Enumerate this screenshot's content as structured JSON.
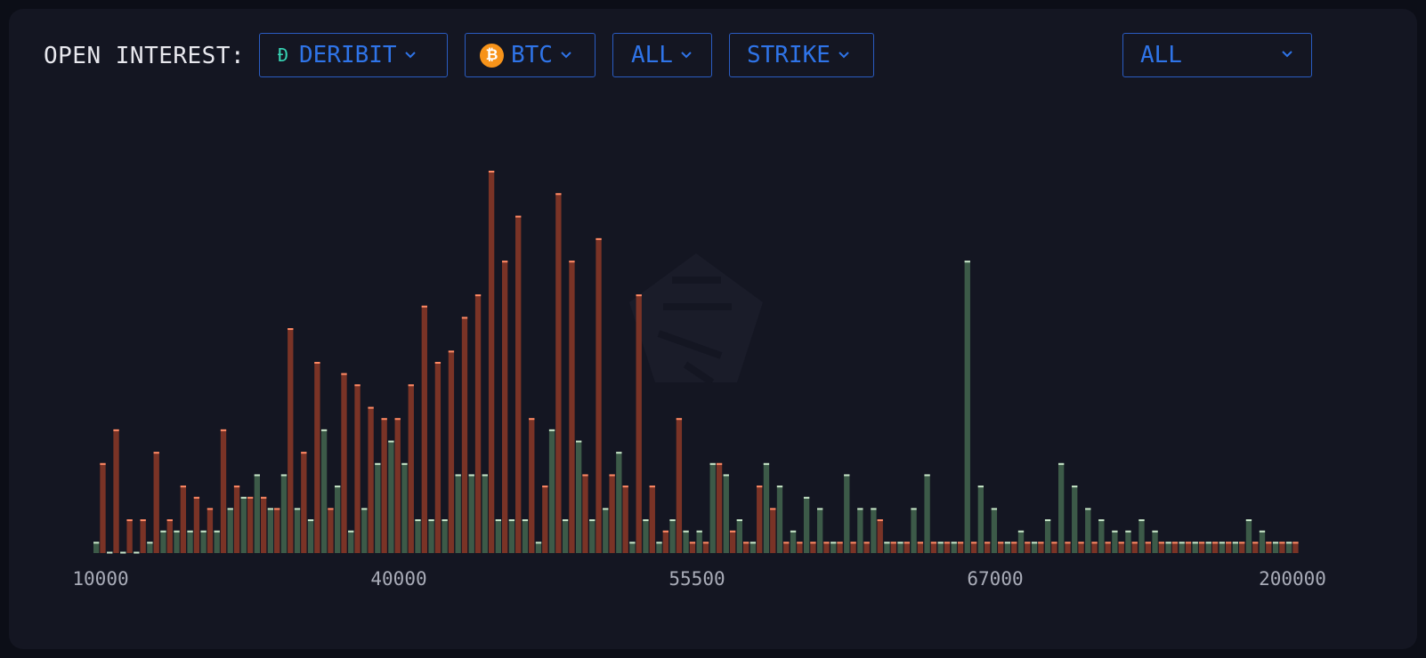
{
  "header": {
    "title": "OPEN INTEREST:",
    "exchange": "DERIBIT",
    "asset": "BTC",
    "expiry": "ALL",
    "group_by": "STRIKE",
    "filter": "ALL"
  },
  "icons": {
    "exchange": "deribit-icon",
    "asset": "bitcoin-icon",
    "dropdown": "chevron-down-icon",
    "watermark": "logo-watermark"
  },
  "colors": {
    "calls": "#3c5a48",
    "puts": "#7a3326",
    "accent": "#2f74e8"
  },
  "chart_data": {
    "type": "bar",
    "title": "",
    "xlabel": "",
    "ylabel": "",
    "x_tick_labels": [
      "10000",
      "40000",
      "55500",
      "67000",
      "200000"
    ],
    "grid": false,
    "y_axis_visible": false,
    "series": [
      {
        "color": "#3c5a48",
        "values": [
          1,
          0,
          0,
          0,
          1,
          2,
          2,
          2,
          2,
          2,
          4,
          5,
          7,
          4,
          7,
          4,
          3,
          11,
          6,
          2,
          4,
          8,
          10,
          8,
          3,
          3,
          3,
          7,
          7,
          7,
          3,
          3,
          3,
          1,
          11,
          3,
          10,
          3,
          4,
          9,
          1,
          3,
          1,
          3,
          2,
          2,
          8,
          7,
          3,
          1,
          8,
          6,
          2,
          5,
          4,
          1,
          7,
          4,
          4,
          1,
          1,
          4,
          7,
          1,
          1,
          26,
          6,
          4,
          1,
          2,
          1,
          3,
          8,
          6,
          4,
          3,
          2,
          2,
          3,
          2,
          1,
          1,
          1,
          1,
          1,
          1,
          3,
          2,
          1,
          1
        ]
      },
      {
        "color": "#7a3326",
        "values": [
          8,
          11,
          3,
          3,
          9,
          3,
          6,
          5,
          4,
          11,
          6,
          5,
          5,
          4,
          20,
          9,
          17,
          4,
          16,
          15,
          13,
          12,
          12,
          15,
          22,
          17,
          18,
          21,
          23,
          34,
          26,
          30,
          12,
          6,
          32,
          26,
          7,
          28,
          7,
          6,
          23,
          6,
          2,
          12,
          1,
          1,
          8,
          2,
          1,
          6,
          4,
          1,
          1,
          1,
          1,
          1,
          1,
          1,
          3,
          1,
          1,
          1,
          1,
          1,
          1,
          1,
          1,
          1,
          1,
          1,
          1,
          1,
          1,
          1,
          1,
          1,
          1,
          1,
          1,
          1,
          1,
          1,
          1,
          1,
          1,
          1,
          1,
          1,
          1,
          1
        ]
      }
    ]
  }
}
